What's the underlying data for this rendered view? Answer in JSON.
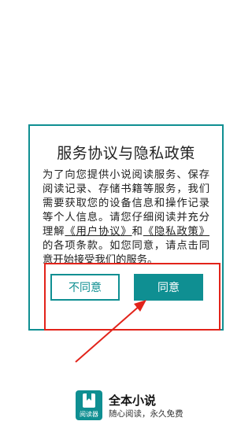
{
  "dialog": {
    "title": "服务协议与隐私政策",
    "body": {
      "part1": "为了向您提供小说阅读服务、保存阅读记录、存储书籍等服务，我们需要获取您的设备信息和操作记录等个人信息。请您仔细阅读并充分理解",
      "user_agreement": "《用户协议》",
      "conj": "和",
      "privacy_policy": "《隐私政策》",
      "part2": "的各项条款。如您同意，请点击同意开始接受我们的服务。"
    },
    "decline_label": "不同意",
    "agree_label": "同意"
  },
  "app": {
    "name": "全本小说",
    "logo_caption": "阅读器",
    "slogan": "随心阅读，永久免费"
  },
  "colors": {
    "accent": "#0f8f92",
    "annotation": "#e2231a"
  }
}
